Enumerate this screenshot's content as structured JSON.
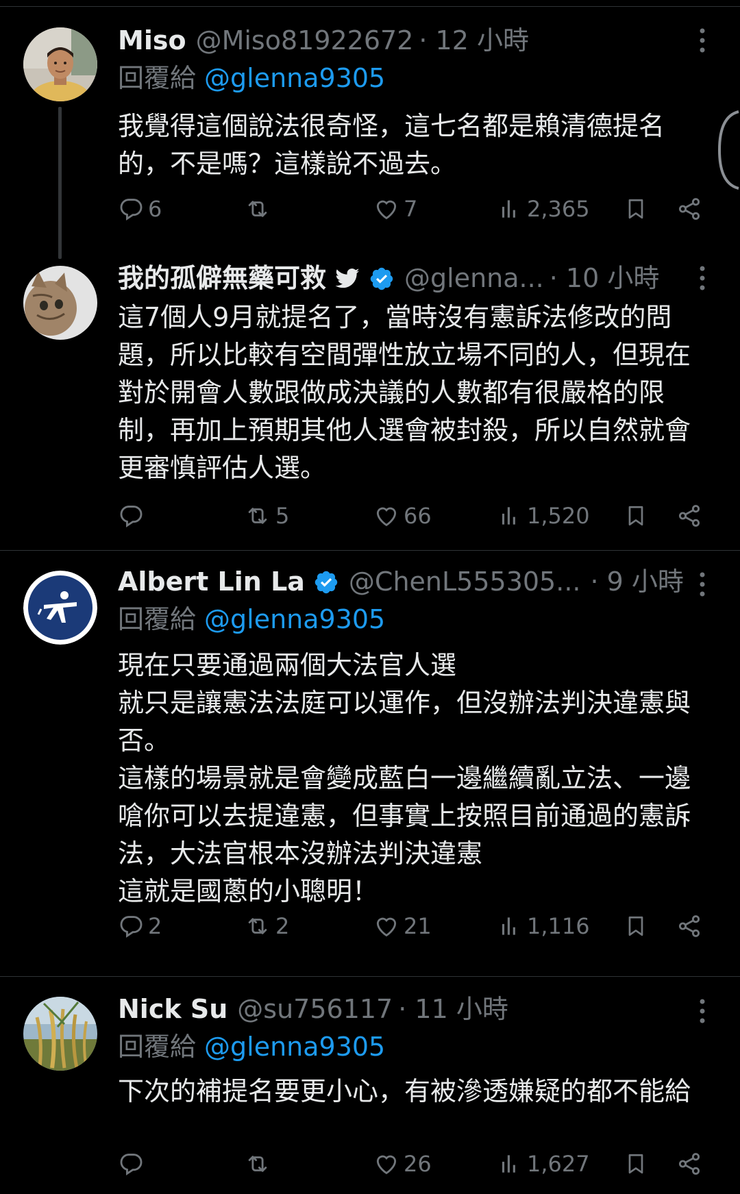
{
  "tweets": [
    {
      "name": "Miso",
      "handle": "@Miso81922672",
      "time": "· 12 小時",
      "reply_label": "回覆給",
      "reply_handle": "@glenna9305",
      "text": "我覺得這個說法很奇怪，這七名都是賴清德提名的，不是嗎？這樣說不過去。",
      "counts": {
        "reply": "6",
        "retweet": "",
        "like": "7",
        "views": "2,365"
      }
    },
    {
      "name": "我的孤僻無藥可救",
      "handle": "@glenna...",
      "time": "· 10 小時",
      "text": "這7個人9月就提名了，當時沒有憲訴法修改的問題，所以比較有空間彈性放立場不同的人，但現在對於開會人數跟做成決議的人數都有很嚴格的限制，再加上預期其他人選會被封殺，所以自然就會更審慎評估人選。",
      "counts": {
        "reply": "",
        "retweet": "5",
        "like": "66",
        "views": "1,520"
      }
    },
    {
      "name": "Albert Lin La",
      "handle": "@ChenL555305...",
      "time": "· 9 小時",
      "reply_label": "回覆給",
      "reply_handle": "@glenna9305",
      "text": "現在只要通過兩個大法官人選\n就只是讓憲法法庭可以運作，但沒辦法判決違憲與否。\n這樣的場景就是會變成藍白一邊繼續亂立法、一邊嗆你可以去提違憲，但事實上按照目前通過的憲訴法，大法官根本沒辦法判決違憲\n這就是國蔥的小聰明！",
      "counts": {
        "reply": "2",
        "retweet": "2",
        "like": "21",
        "views": "1,116"
      }
    },
    {
      "name": "Nick Su",
      "handle": "@su756117",
      "time": "· 11 小時",
      "reply_label": "回覆給",
      "reply_handle": "@glenna9305",
      "text": "下次的補提名要更小心，有被滲透嫌疑的都不能給",
      "counts": {
        "reply": "",
        "retweet": "",
        "like": "26",
        "views": "1,627"
      }
    }
  ],
  "icons": {
    "reply": "reply-icon",
    "retweet": "retweet-icon",
    "like": "heart-icon",
    "views": "views-icon",
    "bookmark": "bookmark-icon",
    "share": "share-icon",
    "more": "more-icon",
    "verified": "verified-badge-icon"
  },
  "colors": {
    "background": "#000000",
    "text": "#e7e9ea",
    "muted": "#71767b",
    "link": "#1d9bf0",
    "divider": "#2f3336"
  }
}
